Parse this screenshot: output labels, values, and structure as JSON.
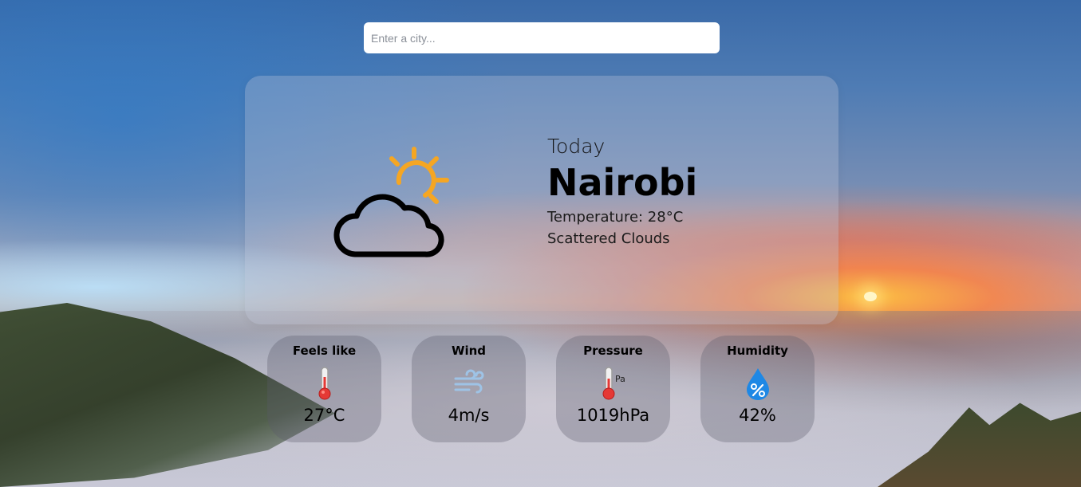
{
  "search": {
    "placeholder": "Enter a city..."
  },
  "current": {
    "heading": "Today",
    "city": "Nairobi",
    "temperature": "Temperature: 28°C",
    "description": "Scattered Clouds",
    "icon": "partly-cloudy-icon"
  },
  "stats": [
    {
      "title": "Feels like",
      "value": "27°C",
      "icon": "thermometer-icon"
    },
    {
      "title": "Wind",
      "value": "4m/s",
      "icon": "wind-icon"
    },
    {
      "title": "Pressure",
      "value": "1019hPa",
      "icon": "pressure-icon",
      "icon_unit": "Pa"
    },
    {
      "title": "Humidity",
      "value": "42%",
      "icon": "humidity-icon"
    }
  ],
  "colors": {
    "sun": "#f5a623",
    "cloud_stroke": "#000000",
    "thermometer_red": "#e53935",
    "water_blue": "#1e88e5"
  }
}
